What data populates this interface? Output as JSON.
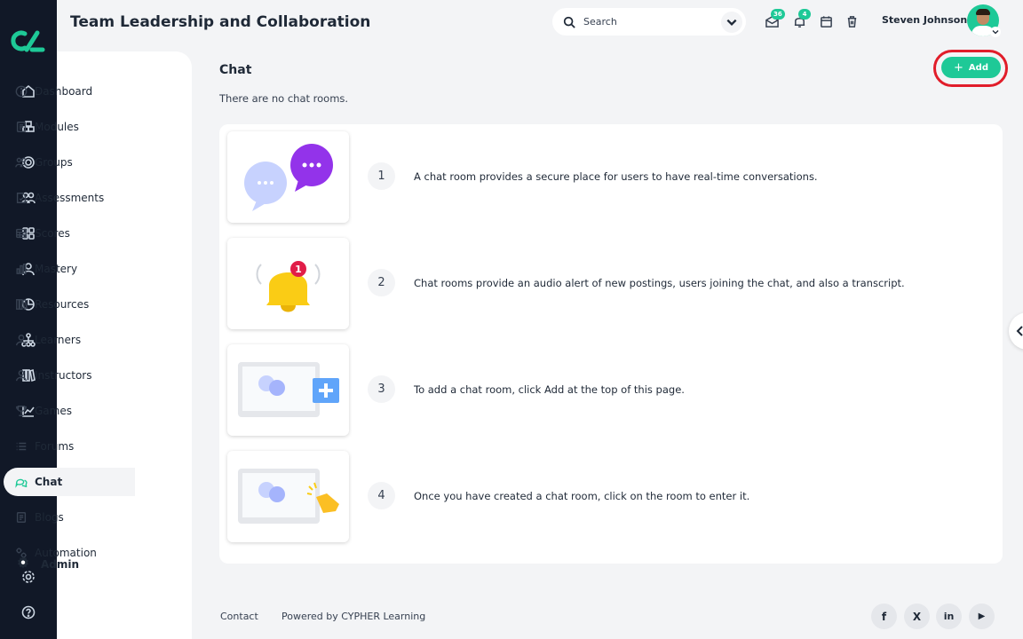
{
  "header": {
    "title": "Team Leadership and Collaboration",
    "search_placeholder": "Search",
    "messages_badge": "36",
    "notifications_badge": "4",
    "user_name": "Steven Johnson"
  },
  "sidebar": {
    "items": [
      {
        "label": "Dashboard",
        "icon": "info-icon"
      },
      {
        "label": "Modules",
        "icon": "book-icon"
      },
      {
        "label": "Groups",
        "icon": "groups-icon"
      },
      {
        "label": "Assessments",
        "icon": "document-icon"
      },
      {
        "label": "Scores",
        "icon": "table-icon"
      },
      {
        "label": "Mastery",
        "icon": "bar-chart-icon"
      },
      {
        "label": "Resources",
        "icon": "library-icon"
      },
      {
        "label": "Learners",
        "icon": "user-icon"
      },
      {
        "label": "Instructors",
        "icon": "instructor-icon"
      },
      {
        "label": "Games",
        "icon": "trophy-icon"
      },
      {
        "label": "Forums",
        "icon": "list-icon"
      },
      {
        "label": "Chat",
        "icon": "chat-icon",
        "active": true
      },
      {
        "label": "Blogs",
        "icon": "blog-icon"
      },
      {
        "label": "Automation",
        "icon": "automation-icon"
      }
    ],
    "admin_label": "Admin"
  },
  "main": {
    "page_title": "Chat",
    "add_button_label": "Add",
    "empty_message": "There are no chat rooms.",
    "steps": [
      {
        "number": "1",
        "text": "A chat room provides a secure place for users to have real-time conversations."
      },
      {
        "number": "2",
        "text": "Chat rooms provide an audio alert of new postings, users joining the chat, and also a transcript."
      },
      {
        "number": "3",
        "text": "To add a chat room, click Add at the top of this page."
      },
      {
        "number": "4",
        "text": "Once you have created a chat room, click on the room to enter it."
      }
    ],
    "bell_badge": "1"
  },
  "footer": {
    "contact": "Contact",
    "powered_by": "Powered by CYPHER Learning",
    "social": [
      "f",
      "X",
      "in",
      "▶"
    ]
  },
  "colors": {
    "accent": "#1ec997",
    "rail": "#111827",
    "highlight_ring": "#e11d2a",
    "background": "#f3f4f6"
  }
}
